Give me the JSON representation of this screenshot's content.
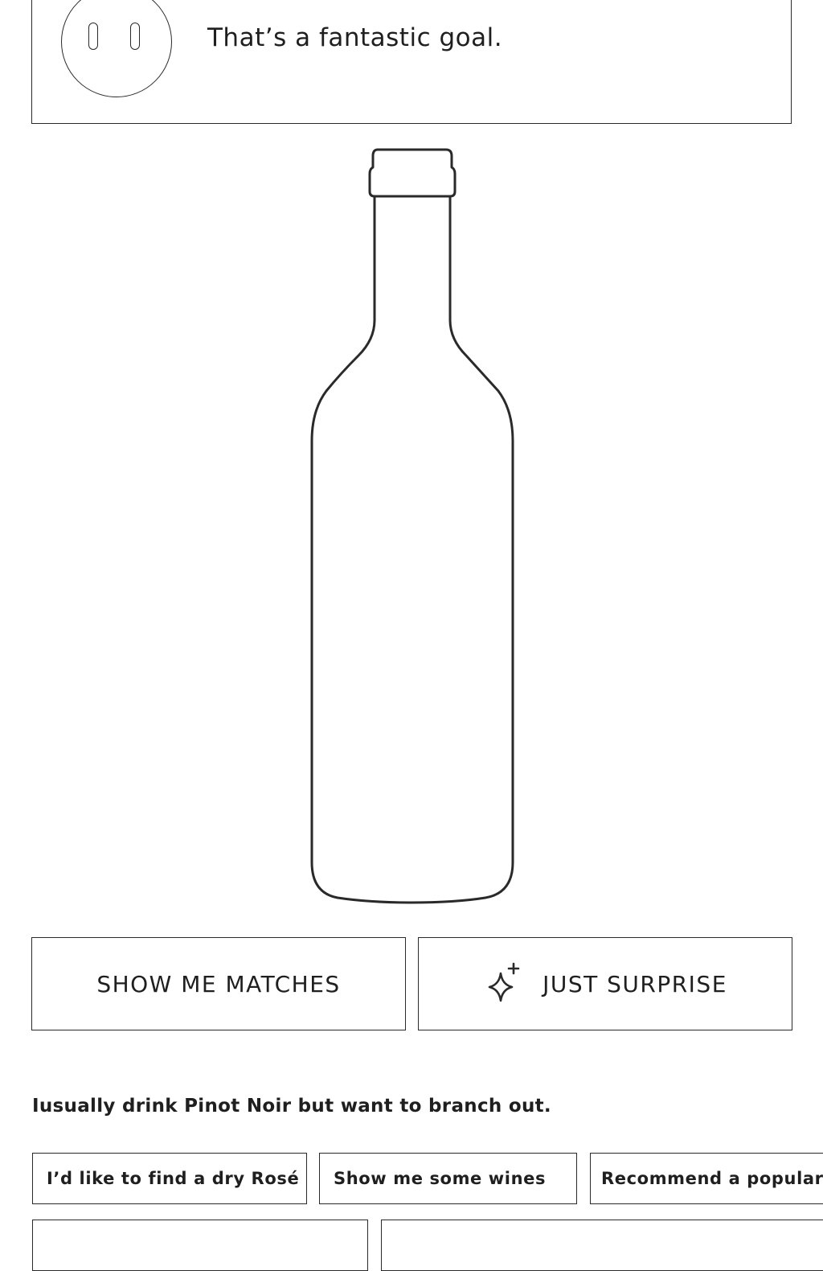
{
  "message": {
    "text": "That’s a fantastic goal.",
    "avatar_icon": "face-avatar-icon"
  },
  "illustration": {
    "icon": "wine-bottle-icon"
  },
  "actions": {
    "show_matches_label": "SHOW ME MATCHES",
    "surprise_label": "JUST SURPRISE",
    "surprise_icon": "sparkle-icon"
  },
  "user_message": "Iusually drink Pinot Noir but want to branch out.",
  "suggestions": [
    {
      "label": "I’d like to find a dry Rosé"
    },
    {
      "label": "Show me some wines"
    },
    {
      "label": "Recommend a popular"
    },
    {
      "label": ""
    },
    {
      "label": ""
    }
  ],
  "colors": {
    "stroke": "#2a2a2a",
    "text": "#1f1f1f",
    "background": "#ffffff"
  }
}
